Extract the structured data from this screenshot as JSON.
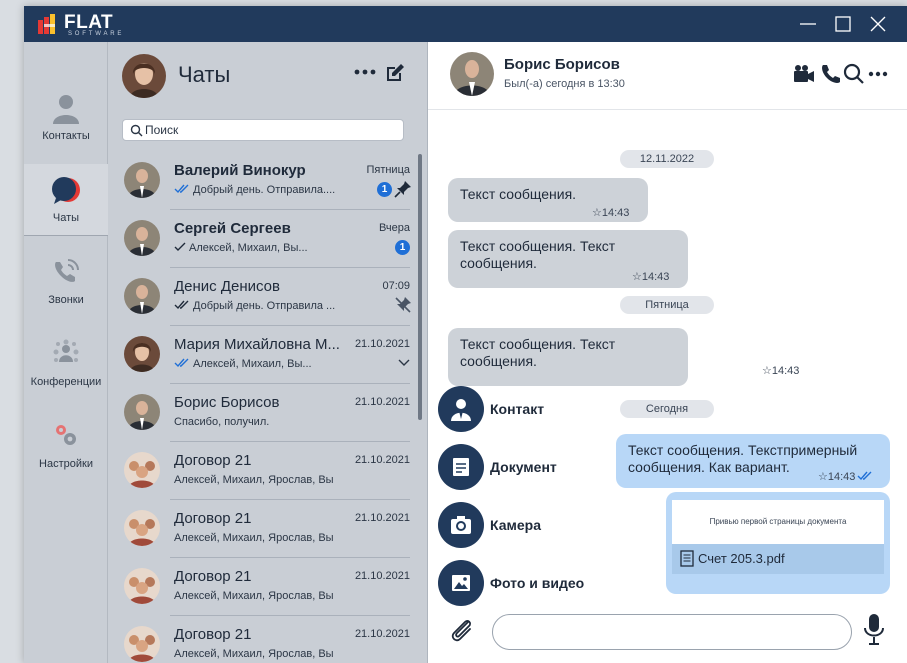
{
  "app": {
    "brand": "FLAT",
    "brand_sub": "SOFTWARE"
  },
  "nav": {
    "items": [
      {
        "label": "Контакты",
        "icon": "contacts-icon"
      },
      {
        "label": "Чаты",
        "icon": "chats-icon"
      },
      {
        "label": "Звонки",
        "icon": "calls-icon"
      },
      {
        "label": "Конференции",
        "icon": "conferences-icon"
      },
      {
        "label": "Настройки",
        "icon": "settings-icon"
      }
    ],
    "active": "Чаты"
  },
  "chat_list": {
    "title": "Чаты",
    "search_placeholder": "Поиск",
    "items": [
      {
        "name": "Валерий Винокур",
        "preview": "Добрый день. Отправила....",
        "date": "Пятница",
        "badge": "1",
        "pinned": true,
        "read": "double"
      },
      {
        "name": "Сергей Сергеев",
        "preview": "Алексей, Михаил, Вы...",
        "date": "Вчера",
        "badge": "1",
        "read": "single"
      },
      {
        "name": "Денис Денисов",
        "preview": "Добрый день. Отправила ...",
        "date": "07:09",
        "muted": true,
        "read": "double-grey"
      },
      {
        "name": "Мария Михайловна М...",
        "preview": "Алексей, Михаил, Вы...",
        "date": "21.10.2021",
        "read": "double"
      },
      {
        "name": "Борис Борисов",
        "preview": "Спасибо, получил.",
        "date": "21.10.2021"
      },
      {
        "name": "Договор 21",
        "preview": "Алексей, Михаил, Ярослав, Вы",
        "date": "21.10.2021"
      },
      {
        "name": "Договор 21",
        "preview": "Алексей, Михаил, Ярослав, Вы",
        "date": "21.10.2021"
      },
      {
        "name": "Договор 21",
        "preview": "Алексей, Михаил, Ярослав, Вы",
        "date": "21.10.2021"
      },
      {
        "name": "Договор 21",
        "preview": "Алексей, Михаил, Ярослав, Вы",
        "date": "21.10.2021"
      }
    ]
  },
  "conversation": {
    "peer_name": "Борис Борисов",
    "peer_status": "Был(-а) сегодня в 13:30",
    "date_dividers": [
      "12.11.2022",
      "Пятница",
      "Сегодня"
    ],
    "messages": [
      {
        "text": "Текст сообщения.",
        "time": "14:43",
        "direction": "in"
      },
      {
        "text": "Текст сообщения. Текст сообщения.",
        "time": "14:43",
        "direction": "in"
      },
      {
        "text": "Текст сообщения. Текст сообщения.",
        "time": "14:43",
        "direction": "in"
      },
      {
        "text": "Текст сообщения. Текстпримерный сообщения. Как вариант.",
        "time": "14:43",
        "direction": "out"
      }
    ],
    "document": {
      "preview_text": "Привью первой страницы документа",
      "filename": "Счет 205.3.pdf"
    },
    "attach_menu": [
      {
        "label": "Контакт",
        "icon": "contact-icon"
      },
      {
        "label": "Документ",
        "icon": "document-icon"
      },
      {
        "label": "Камера",
        "icon": "camera-icon"
      },
      {
        "label": "Фото и видео",
        "icon": "photo-icon"
      }
    ],
    "composer_value": ""
  },
  "colors": {
    "titlebar": "#213a5c",
    "sidebar": "#c9ced5",
    "accent": "#1f6fd6",
    "bubble_in": "#cdd2d8",
    "bubble_out": "#b8d7f7"
  }
}
